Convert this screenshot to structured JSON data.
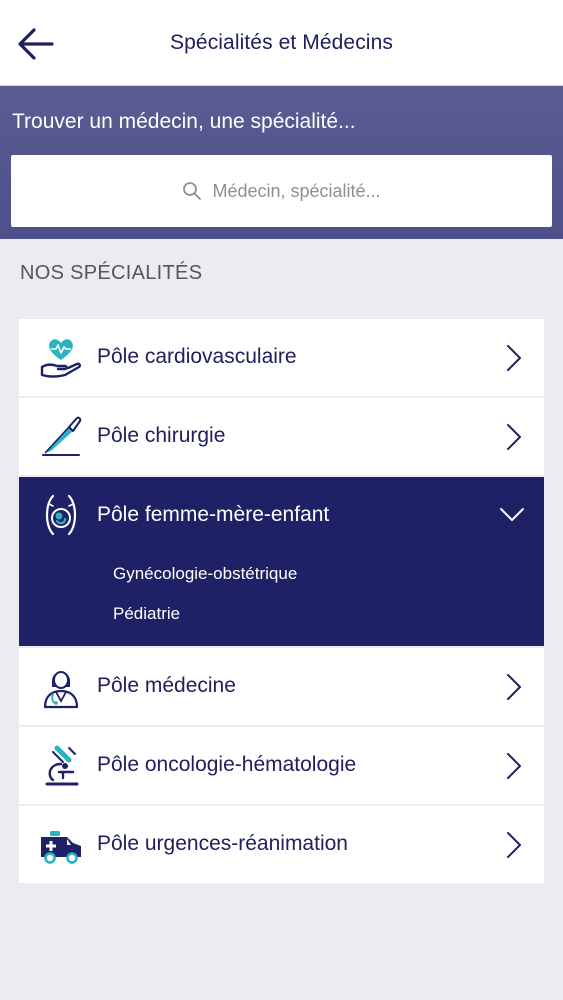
{
  "header": {
    "title": "Spécialités et Médecins",
    "back_icon": "arrow-left-icon"
  },
  "search": {
    "heading": "Trouver un médecin, une spécialité...",
    "placeholder": "Médecin, spécialité..."
  },
  "section": {
    "label": "NOS SPÉCIALITÉS"
  },
  "specialties": [
    {
      "label": "Pôle cardiovasculaire",
      "icon": "heart-hand-icon",
      "expanded": false
    },
    {
      "label": "Pôle chirurgie",
      "icon": "scalpel-icon",
      "expanded": false
    },
    {
      "label": "Pôle femme-mère-enfant",
      "icon": "pregnancy-icon",
      "expanded": true,
      "children": [
        {
          "label": "Gynécologie-obstétrique"
        },
        {
          "label": "Pédiatrie"
        }
      ]
    },
    {
      "label": "Pôle médecine",
      "icon": "doctor-icon",
      "expanded": false
    },
    {
      "label": "Pôle oncologie-hématologie",
      "icon": "microscope-icon",
      "expanded": false
    },
    {
      "label": "Pôle urgences-réanimation",
      "icon": "ambulance-icon",
      "expanded": false
    }
  ],
  "colors": {
    "primary": "#1f2167",
    "band": "#5a5d93",
    "accent": "#2bb3c0",
    "background": "#ebebf0"
  }
}
